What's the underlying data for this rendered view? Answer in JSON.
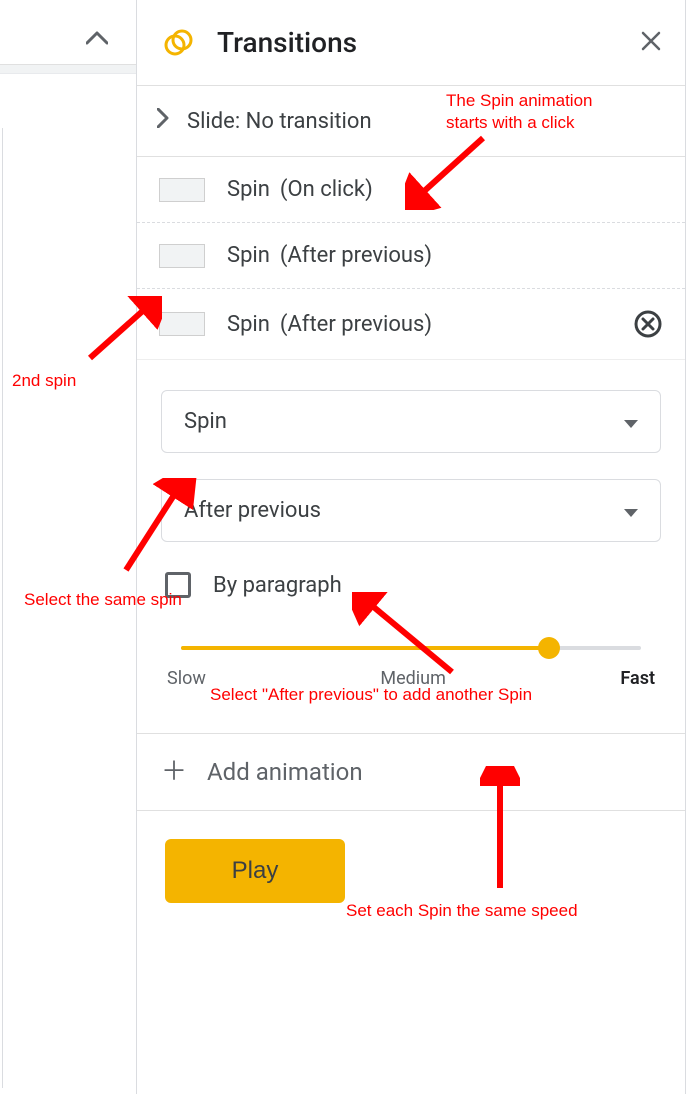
{
  "header": {
    "title": "Transitions"
  },
  "slide_row": {
    "label": "Slide: No transition"
  },
  "animations": [
    {
      "name": "Spin",
      "trigger": "(On click)"
    },
    {
      "name": "Spin",
      "trigger": "(After previous)"
    },
    {
      "name": "Spin",
      "trigger": "(After previous)"
    }
  ],
  "detail": {
    "effect_dropdown": "Spin",
    "trigger_dropdown": "After previous",
    "by_paragraph_label": "By paragraph",
    "speed": {
      "slow": "Slow",
      "medium": "Medium",
      "fast": "Fast",
      "value_pct": 80
    }
  },
  "add_animation_label": "Add animation",
  "play_label": "Play",
  "annotations": {
    "a1": "The Spin animation\nstarts with a click",
    "a2": "2nd spin",
    "a3": "Select the same spin",
    "a4": "Select \"After previous\" to add another Spin",
    "a5": "Set each Spin the same speed"
  }
}
